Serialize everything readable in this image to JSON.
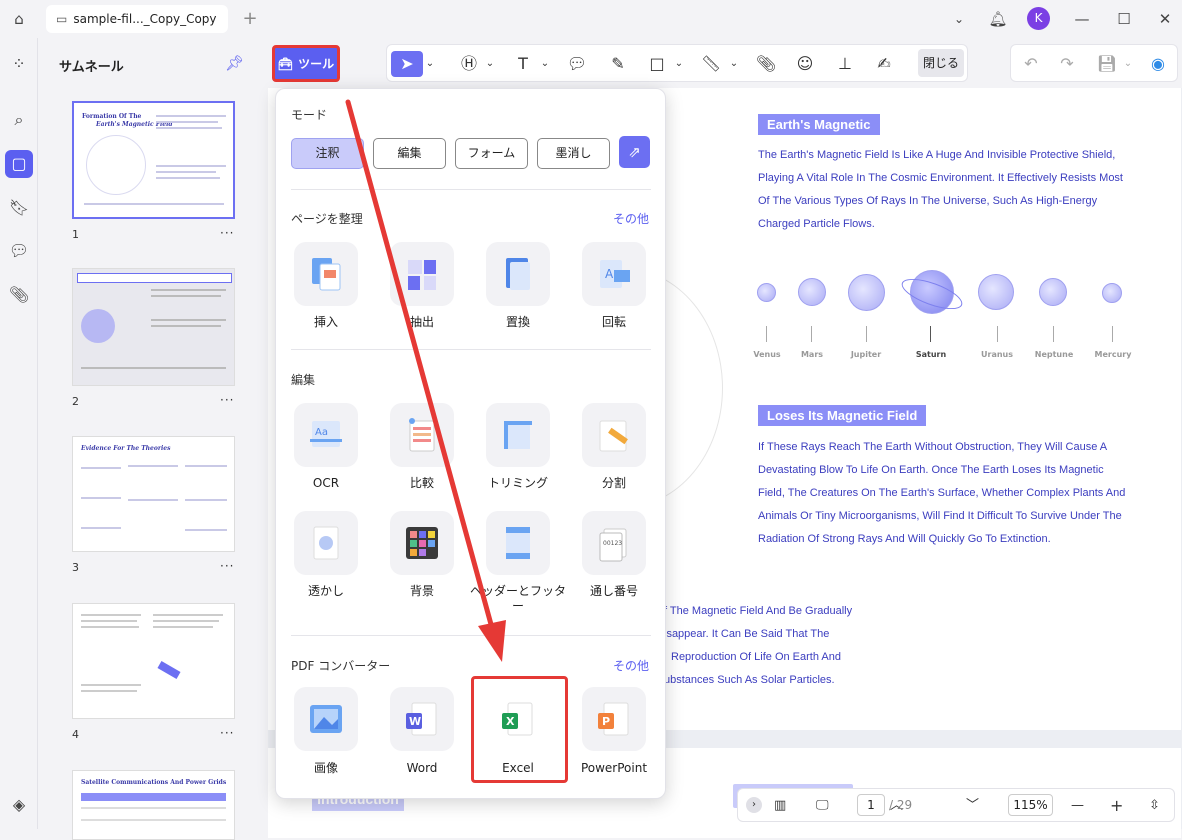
{
  "titlebar": {
    "tab_title": "sample-fil..._Copy_Copy",
    "avatar_letter": "K"
  },
  "thumbnail_panel": {
    "title": "サムネール",
    "thumbnails": [
      {
        "page": "1",
        "heading": "Formation Of The",
        "heading2": "Earth's Magnetic Field"
      },
      {
        "page": "2"
      },
      {
        "page": "3",
        "heading": "Evidence For The Theories"
      },
      {
        "page": "4"
      },
      {
        "page": "",
        "heading": "Satellite Communications And Power Grids"
      }
    ],
    "more": "···"
  },
  "toolbar": {
    "tools_label": "ツール",
    "close_label": "閉じる"
  },
  "tools_panel": {
    "mode_title": "モード",
    "modes": [
      "注釈",
      "編集",
      "フォーム",
      "墨消し"
    ],
    "selected_mode": "注釈",
    "organize": {
      "title": "ページを整理",
      "more": "その他",
      "items": [
        "挿入",
        "抽出",
        "置換",
        "回転"
      ]
    },
    "edit": {
      "title": "編集",
      "items": [
        "OCR",
        "比較",
        "トリミング",
        "分割",
        "透かし",
        "背景",
        "ヘッダーとフッター",
        "通し番号"
      ]
    },
    "converter": {
      "title": "PDF コンバーター",
      "more": "その他",
      "items": [
        "画像",
        "Word",
        "Excel",
        "PowerPoint"
      ],
      "highlighted": "Excel"
    }
  },
  "document": {
    "heading1": "Earth's Magnetic",
    "para1": "The Earth's Magnetic Field Is Like A Huge And Invisible Protective Shield, Playing A Vital Role In The Cosmic Environment. It Effectively Resists Most Of The Various Types Of Rays In The Universe, Such As High-Energy Charged Particle Flows.",
    "planets": [
      "Venus",
      "Mars",
      "Jupiter",
      "Saturn",
      "Uranus",
      "Neptune",
      "Mercury"
    ],
    "heading2": "Loses Its Magnetic Field",
    "para2": "If These Rays Reach The Earth Without Obstruction, They Will Cause A Devastating Blow To Life On Earth. Once The Earth Loses Its Magnetic Field, The Creatures On The Earth's Surface, Whether Complex Plants And Animals Or Tiny Microorganisms, Will Find It Difficult To Survive Under The Radiation Of Strong Rays And Will Quickly Go To Extinction.",
    "para3_lines": [
      "f The Magnetic Field And Be Gradually",
      "isappear. It Can Be Said That The",
      "Reproduction Of Life On Earth And",
      "ubstances Such As Solar Particles."
    ],
    "page2_heading": "Introduction"
  },
  "statusbar": {
    "current_page": "1",
    "total_pages": "/ 29",
    "zoom": "115%"
  },
  "colors": {
    "accent": "#5b5ff0",
    "highlight_red": "#e53935"
  }
}
